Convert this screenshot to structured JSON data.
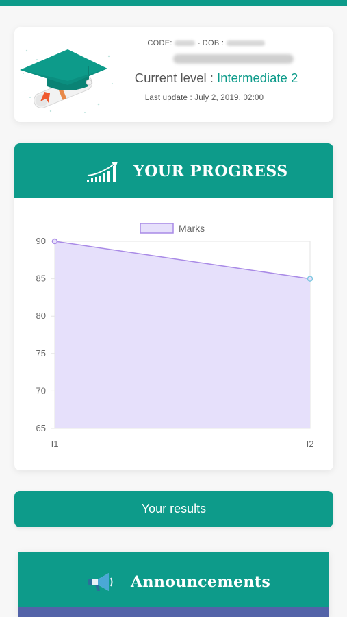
{
  "profile": {
    "code_label": "CODE:",
    "dob_label": "- DOB :",
    "level_label": "Current level :",
    "level_value": "Intermediate 2",
    "last_update": "Last update : July 2, 2019, 02:00"
  },
  "progress": {
    "title": "YOUR PROGRESS"
  },
  "chart_data": {
    "type": "area",
    "legend": [
      "Marks"
    ],
    "categories": [
      "I1",
      "I2"
    ],
    "series": [
      {
        "name": "Marks",
        "values": [
          90,
          85
        ]
      }
    ],
    "ylim": [
      65,
      90
    ],
    "yticks": [
      90,
      85,
      80,
      75,
      70,
      65
    ],
    "grid": true,
    "legend_position": "top",
    "colors": {
      "fill": "#e6e0fb",
      "line": "#a98ae6",
      "point_start": "#a98ae6",
      "point_end": "#7cc8e0"
    }
  },
  "results_button": {
    "label": "Your results"
  },
  "announcements": {
    "title": "Announcements"
  },
  "colors": {
    "accent": "#0d9b8a",
    "strip": "#5363a8"
  },
  "icons": {
    "graduation": "graduation-cap-icon",
    "progress": "progress-chart-icon",
    "megaphone": "megaphone-icon"
  }
}
